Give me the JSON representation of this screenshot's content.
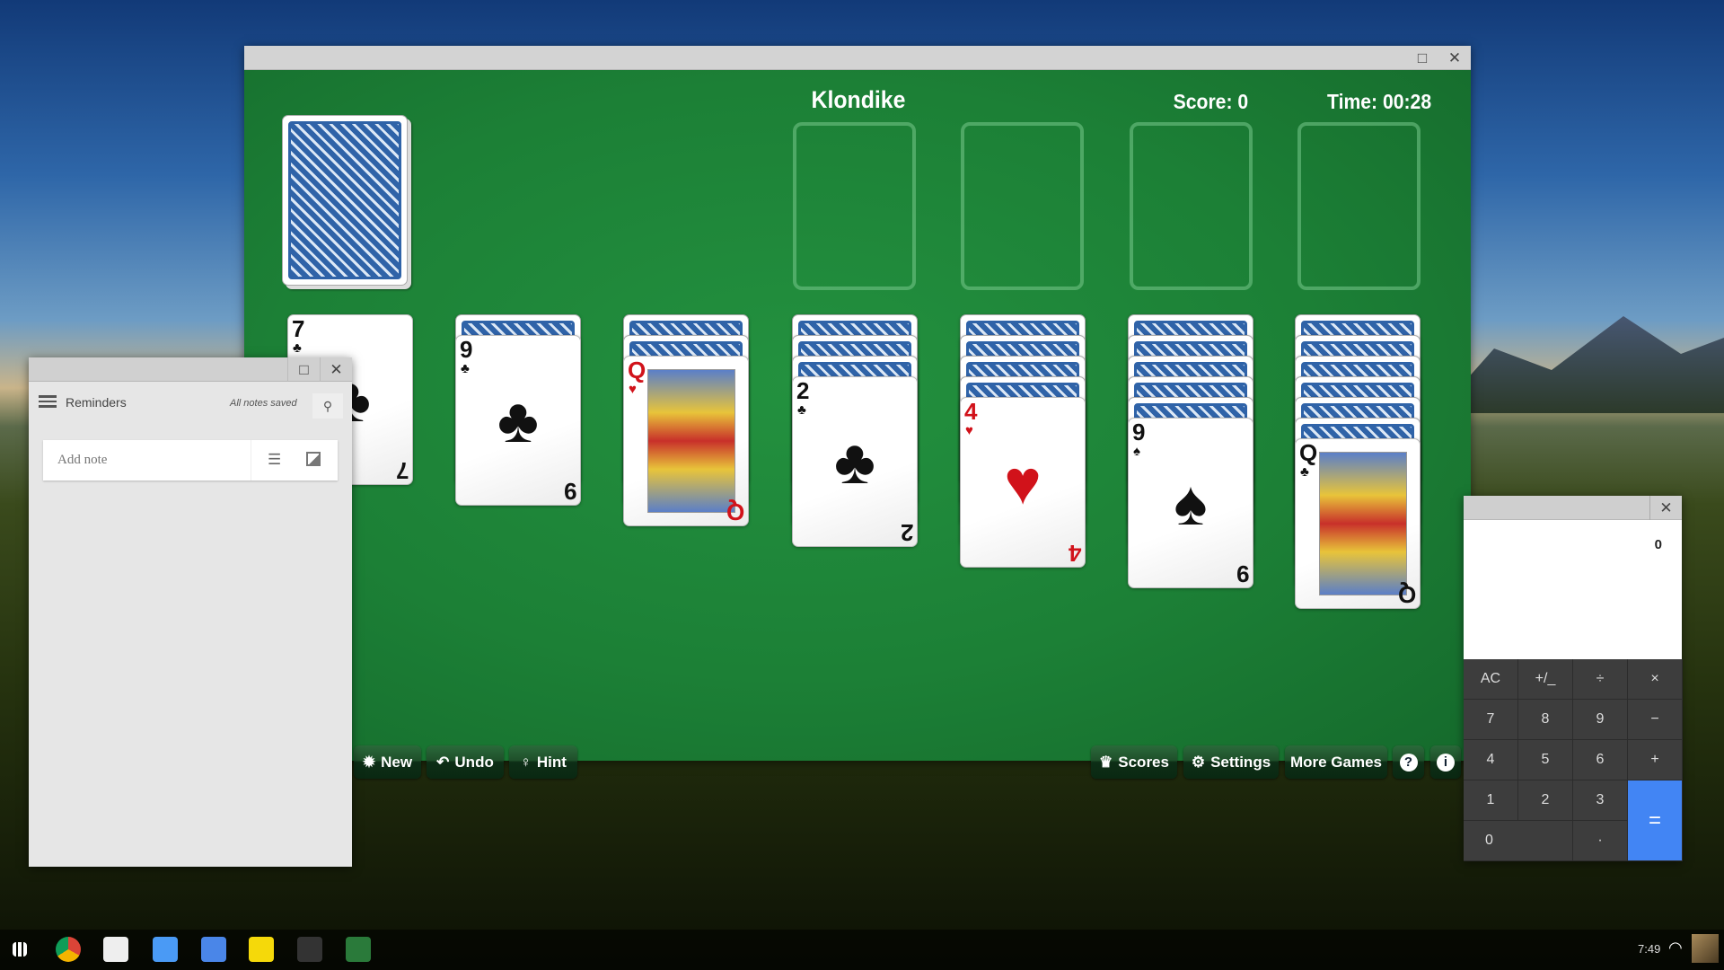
{
  "solitaire": {
    "title": "Klondike",
    "score": "Score: 0",
    "time": "Time: 00:28",
    "stock": {
      "face_down": true
    },
    "foundations": [
      {
        "empty": true
      },
      {
        "empty": true
      },
      {
        "empty": true
      },
      {
        "empty": true
      }
    ],
    "tableau": [
      {
        "face_down": 0,
        "card": {
          "rank": "7",
          "suit": "♣",
          "suit_name": "clubs",
          "color": "black"
        }
      },
      {
        "face_down": 1,
        "card": {
          "rank": "9",
          "suit": "♣",
          "suit_name": "clubs",
          "color": "black"
        }
      },
      {
        "face_down": 2,
        "card": {
          "rank": "Q",
          "suit": "♥",
          "suit_name": "hearts",
          "color": "red"
        }
      },
      {
        "face_down": 3,
        "card": {
          "rank": "2",
          "suit": "♣",
          "suit_name": "clubs",
          "color": "black"
        }
      },
      {
        "face_down": 4,
        "card": {
          "rank": "4",
          "suit": "♥",
          "suit_name": "hearts",
          "color": "red"
        }
      },
      {
        "face_down": 5,
        "card": {
          "rank": "9",
          "suit": "♠",
          "suit_name": "spades",
          "color": "black"
        }
      },
      {
        "face_down": 6,
        "card": {
          "rank": "Q",
          "suit": "♣",
          "suit_name": "clubs",
          "color": "black"
        }
      }
    ],
    "buttons": {
      "new": "New",
      "undo": "Undo",
      "hint": "Hint",
      "scores": "Scores",
      "settings": "Settings",
      "more_games": "More Games",
      "help": "?",
      "info": "i"
    },
    "felt_color": "#1c8036"
  },
  "reminders": {
    "title": "Reminders",
    "status": "All notes saved",
    "add_note_placeholder": "Add note"
  },
  "calculator": {
    "display": "0",
    "keys": [
      "AC",
      "+/_",
      "÷",
      "×",
      "7",
      "8",
      "9",
      "−",
      "4",
      "5",
      "6",
      "+",
      "1",
      "2",
      "3",
      "=",
      "0",
      "·"
    ],
    "accent": "#4285f4"
  },
  "taskbar": {
    "apps": [
      "launcher",
      "chrome",
      "gmail",
      "files",
      "docs",
      "keep",
      "window-manager",
      "solitaire"
    ],
    "time": "7:49"
  }
}
